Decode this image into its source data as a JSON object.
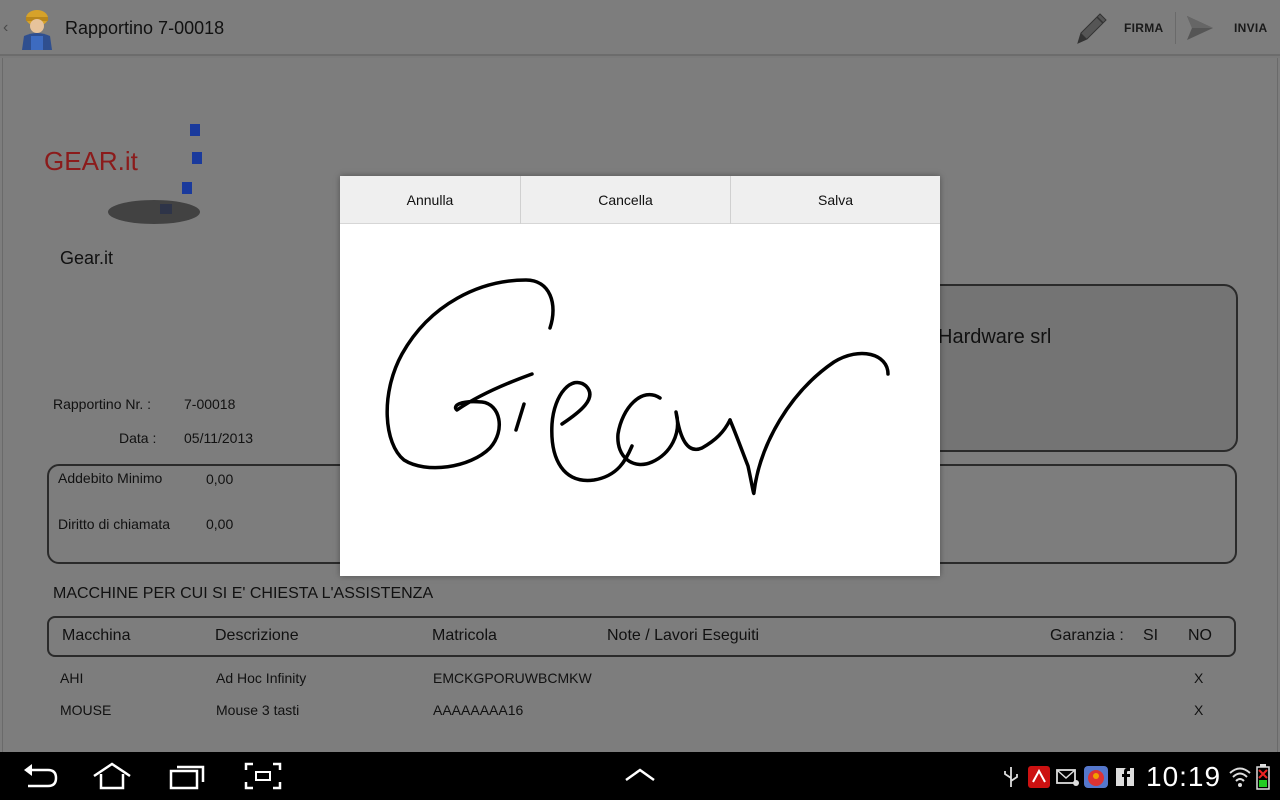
{
  "action_bar": {
    "title": "Rapportino 7-00018",
    "firma_label": "FIRMA",
    "invia_label": "INVIA"
  },
  "document": {
    "logo_text": "GEAR.it",
    "company_name": "Gear.it",
    "customer_name_partial": "Hardware srl",
    "rapportino_label": "Rapportino Nr. :",
    "rapportino_value": "7-00018",
    "data_label": "Data :",
    "data_value": "05/11/2013",
    "addebito_label": "Addebito Minimo",
    "addebito_value": "0,00",
    "diritto_label": "Diritto di chiamata",
    "diritto_value": "0,00",
    "section_title": "MACCHINE PER CUI SI E' CHIESTA L'ASSISTENZA",
    "table_headers": {
      "macchina": "Macchina",
      "descrizione": "Descrizione",
      "matricola": "Matricola",
      "note": "Note / Lavori Eseguiti",
      "garanzia": "Garanzia :",
      "si": "SI",
      "no": "NO"
    },
    "rows": [
      {
        "macchina": "AHI",
        "descrizione": "Ad Hoc Infinity",
        "matricola": "EMCKGPORUWBCMKW",
        "no": "X"
      },
      {
        "macchina": "MOUSE",
        "descrizione": "Mouse 3 tasti",
        "matricola": "AAAAAAAA16",
        "no": "X"
      }
    ]
  },
  "signature_dialog": {
    "annulla_label": "Annulla",
    "cancella_label": "Cancella",
    "salva_label": "Salva",
    "signature_text": "Gear"
  },
  "system_bar": {
    "clock": "10:19",
    "icons": [
      "back-icon",
      "home-icon",
      "recent-apps-icon",
      "screenshot-icon",
      "up-chevron-icon",
      "usb-icon",
      "app-notification-icon",
      "email-icon",
      "game-icon",
      "facebook-icon",
      "wifi-icon",
      "battery-icon"
    ]
  },
  "colors": {
    "dim_overlay": "#7d7d7d",
    "dialog_bar": "#efefef",
    "logo_blue": "#1a3a9c",
    "logo_red": "#8b1b1b"
  }
}
